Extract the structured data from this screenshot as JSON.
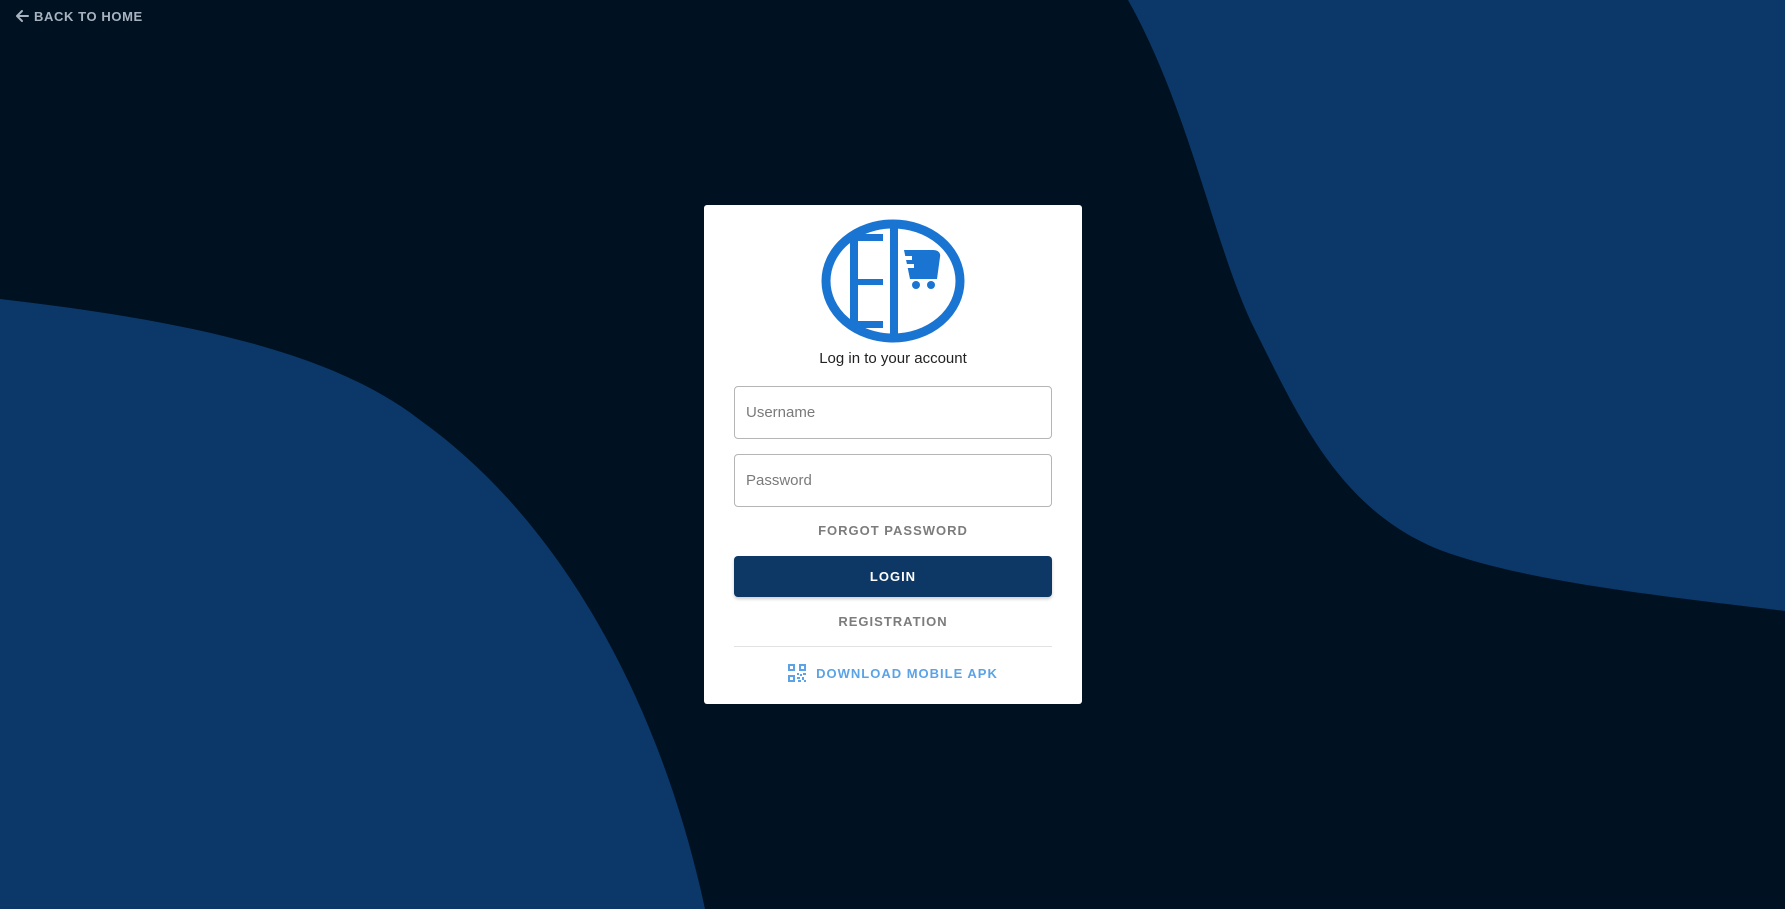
{
  "nav": {
    "back_label": "BACK TO HOME",
    "back_icon": "arrow-left-icon"
  },
  "login": {
    "logo_icon": "ep-cart-logo",
    "heading": "Log in to your account",
    "username_placeholder": "Username",
    "password_placeholder": "Password",
    "forgot_label": "FORGOT PASSWORD",
    "login_label": "LOGIN",
    "register_label": "REGISTRATION",
    "download_label": "DOWNLOAD MOBILE APK",
    "download_icon": "qr-code-icon"
  },
  "colors": {
    "background": "#001121",
    "wave": "#0b3868",
    "primary_button": "#0d3866",
    "logo": "#1a74d2",
    "link_accent": "#5ba3e6"
  }
}
